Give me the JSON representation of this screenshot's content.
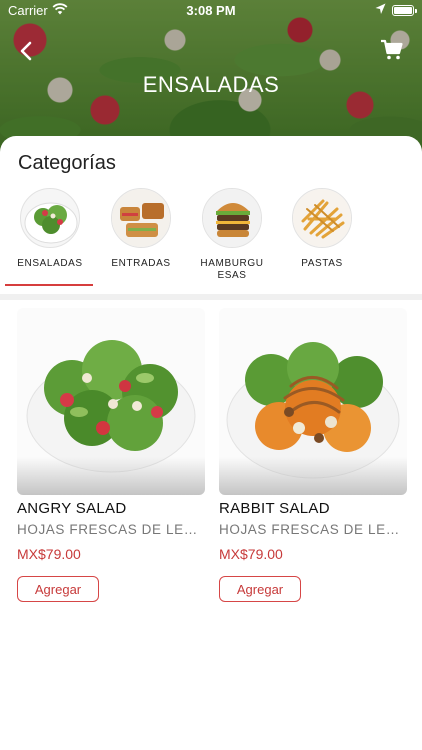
{
  "status_bar": {
    "carrier": "Carrier",
    "time": "3:08 PM"
  },
  "header": {
    "title": "ENSALADAS"
  },
  "categories_section": {
    "title": "Categorías",
    "items": [
      {
        "label": "ENSALADAS",
        "active": true
      },
      {
        "label": "ENTRADAS",
        "active": false
      },
      {
        "label": "HAMBURGUESAS",
        "active": false
      },
      {
        "label": "PASTAS",
        "active": false
      }
    ]
  },
  "products": [
    {
      "name": "ANGRY SALAD",
      "description": "HOJAS FRESCAS DE LECHUGA",
      "price": "MX$79.00",
      "add_label": "Agregar"
    },
    {
      "name": "RABBIT SALAD",
      "description": "HOJAS FRESCAS DE LECHUGA",
      "price": "MX$79.00",
      "add_label": "Agregar"
    }
  ],
  "colors": {
    "accent": "#d63d3d",
    "text": "#1a1a1a",
    "muted": "#777777"
  },
  "icons": [
    "wifi-icon",
    "location-icon",
    "battery-icon",
    "back-icon",
    "cart-icon"
  ]
}
